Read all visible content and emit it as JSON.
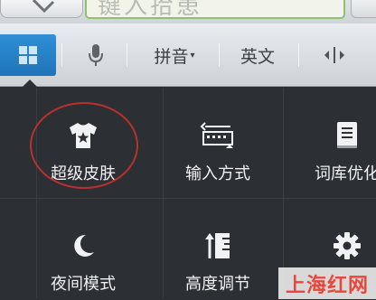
{
  "input": {
    "placeholder": "键入拾患"
  },
  "toolbar": {
    "tabs": [
      {
        "label": "拼音",
        "caret": "▾"
      },
      {
        "label": "英文"
      }
    ]
  },
  "menu": {
    "items": [
      {
        "label": "超级皮肤",
        "icon": "tshirt-star-icon"
      },
      {
        "label": "输入方式",
        "icon": "keyboard-input-icon"
      },
      {
        "label": "词库优化",
        "icon": "dictionary-icon"
      },
      {
        "label": "夜间模式",
        "icon": "moon-icon"
      },
      {
        "label": "高度调节",
        "icon": "height-adjust-icon"
      },
      {
        "label": "",
        "icon": "gear-icon"
      }
    ]
  },
  "watermark": {
    "text": "上海红网"
  },
  "colors": {
    "accent": "#2585c8",
    "panel": "#2c2f33",
    "input_border": "#8fc06d",
    "annotation": "#b8322d",
    "watermark": "#e8473b"
  }
}
